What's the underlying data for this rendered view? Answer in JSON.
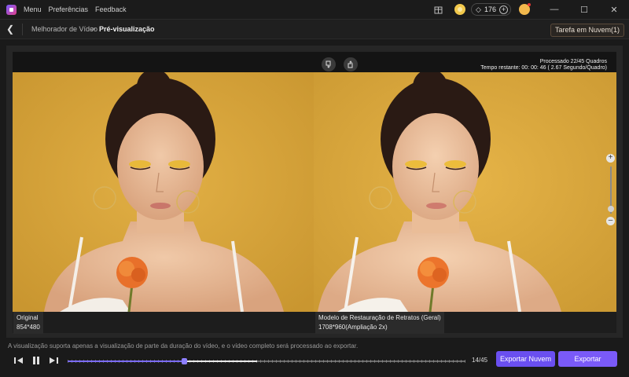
{
  "app": {
    "menu": [
      "Menu",
      "Preferências",
      "Feedback"
    ],
    "credits": "176"
  },
  "breadcrumb": {
    "parent": "Melhorador de Vídeo",
    "separator": ">",
    "current": "Pré-visualização"
  },
  "task_button": "Tarefa em Nuvem(1)",
  "progress": {
    "line1": "Processado 22/45 Quadros",
    "line2": "Tempo restante: 00: 00: 46 ( 2.67 Segundo/Quadro)"
  },
  "panes": {
    "left": {
      "label": "Original",
      "resolution": "854*480"
    },
    "right": {
      "label": "Modelo de Restauração de Retratos (Geral)",
      "resolution": "1708*960(Ampliação 2x)"
    }
  },
  "notice": "A visualização suporta apenas a visualização de parte da duração do vídeo, e o vídeo completo será processado ao exportar.",
  "playback": {
    "frame_counter": "14/45",
    "played_fraction": 0.293,
    "buffered_fraction": 0.477
  },
  "buttons": {
    "cloud_export": "Exportar Nuvem",
    "export": "Exportar"
  },
  "colors": {
    "accent": "#7a5af8",
    "background_yellow": "#d9a43a"
  },
  "icons": [
    "app-logo-icon",
    "gift-icon",
    "coin-icon",
    "gem-icon",
    "plus-icon",
    "avatar-icon",
    "minimize-icon",
    "maximize-icon",
    "close-icon",
    "back-icon",
    "thumbs-down-icon",
    "thumbs-up-icon",
    "zoom-in-icon",
    "zoom-out-icon",
    "step-back-icon",
    "pause-icon",
    "step-forward-icon"
  ]
}
